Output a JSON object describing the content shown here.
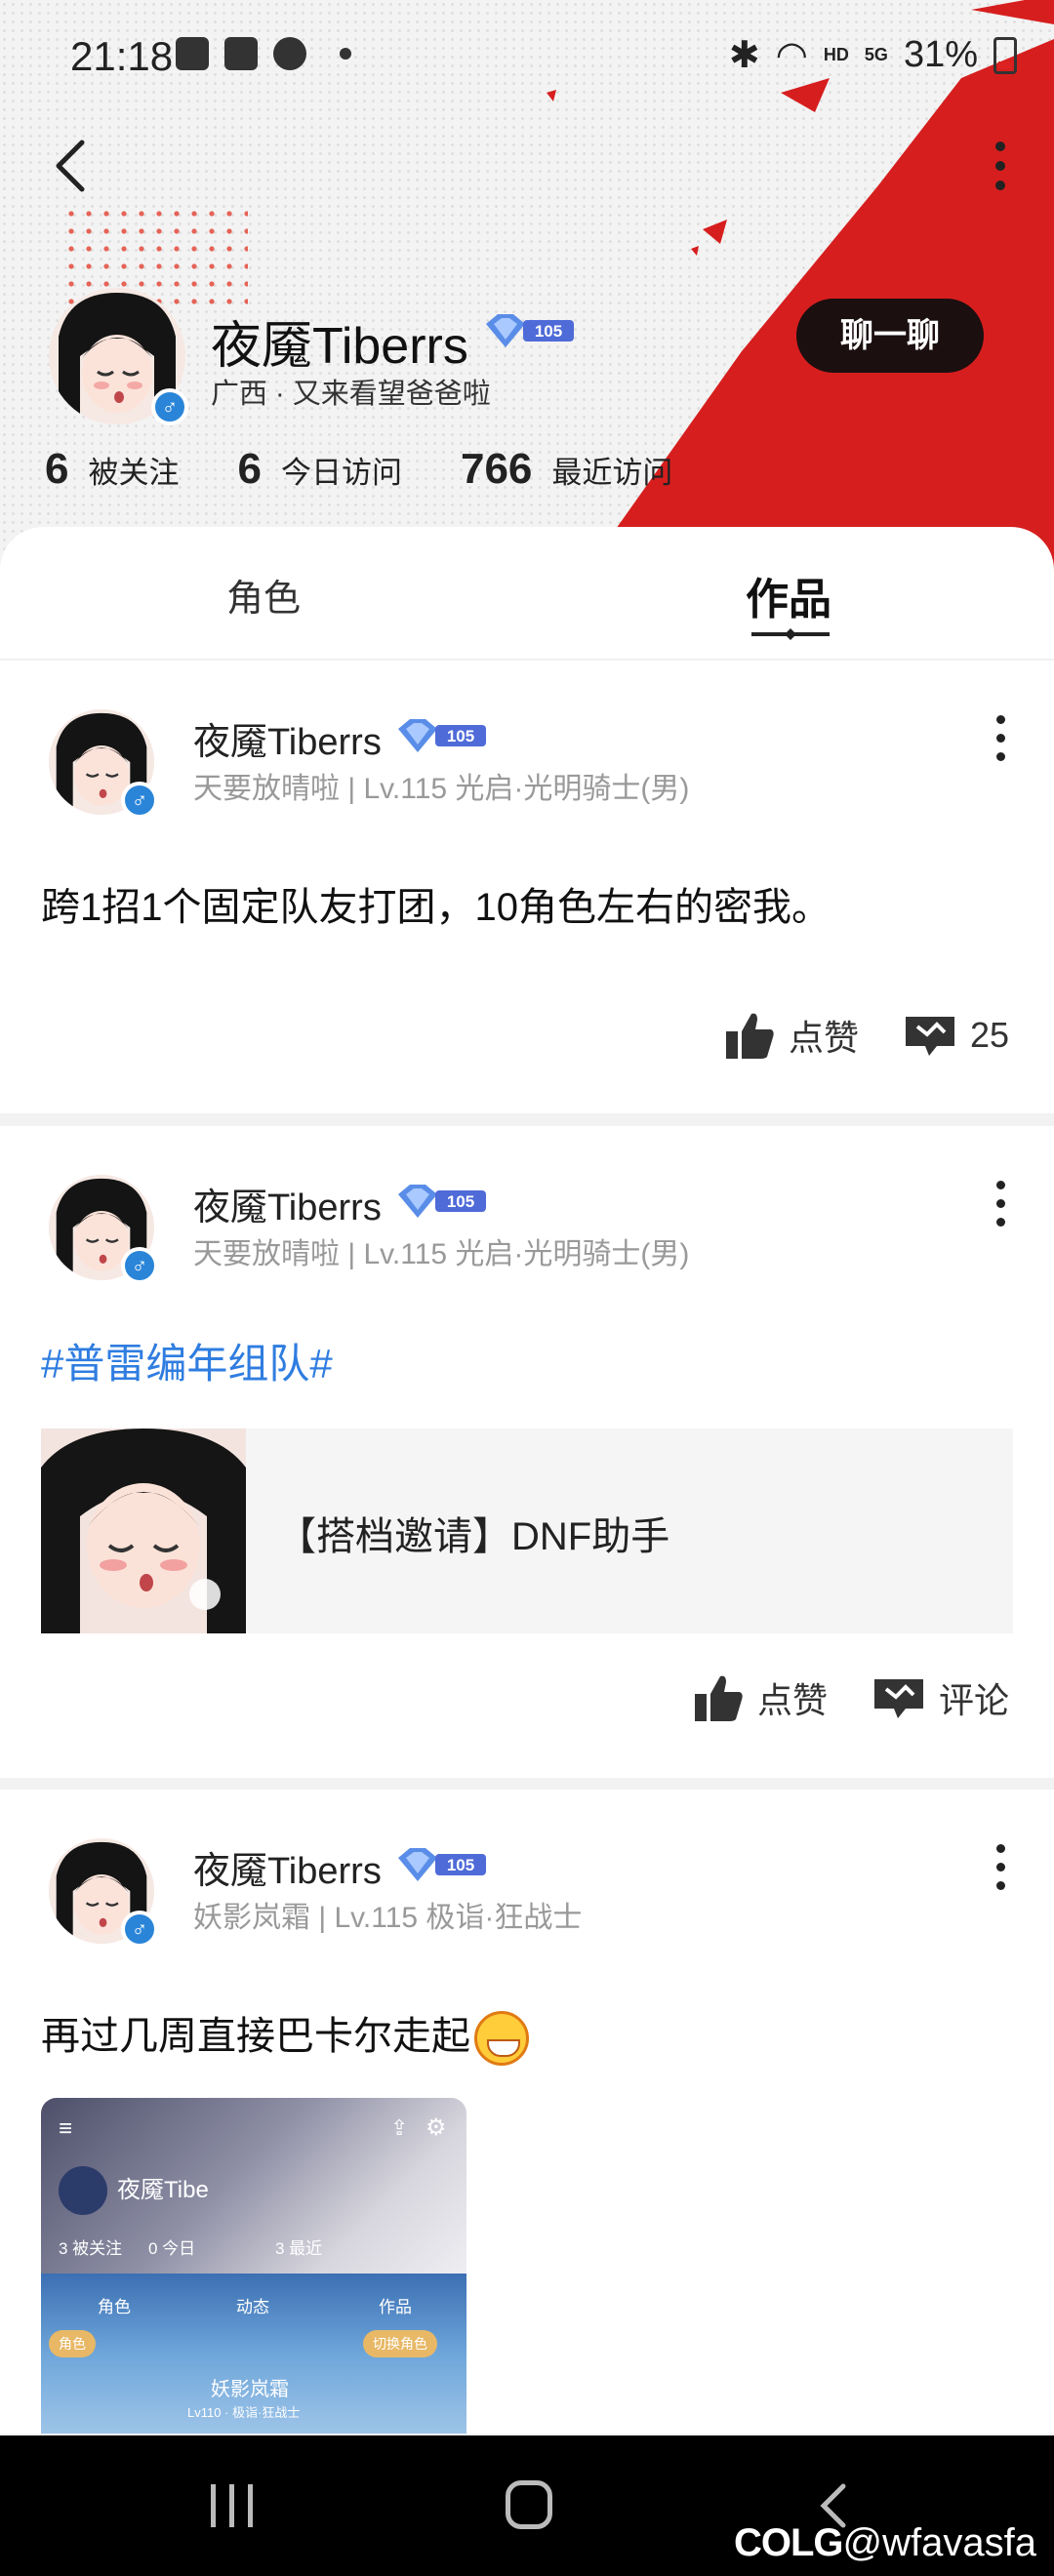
{
  "status_bar": {
    "time": "21:18",
    "network": "HD",
    "signal": "5G",
    "battery": "31%"
  },
  "profile": {
    "name": "夜魇Tiberrs",
    "level": "105",
    "subtitle": "广西 · 又来看望爸爸啦",
    "gender_symbol": "♂",
    "chat_label": "聊一聊",
    "stats": [
      {
        "value": "6",
        "label": "被关注"
      },
      {
        "value": "6",
        "label": "今日访问"
      },
      {
        "value": "766",
        "label": "最近访问"
      }
    ]
  },
  "tabs": [
    {
      "label": "角色"
    },
    {
      "label": "作品",
      "active": true
    }
  ],
  "posts": [
    {
      "author": "夜魇Tiberrs",
      "level": "105",
      "gender_symbol": "♂",
      "meta": "天要放晴啦 | Lv.115 光启·光明骑士(男)",
      "text": "跨1招1个固定队友打团，10角色左右的密我。",
      "like_label": "点赞",
      "comment_count": "25"
    },
    {
      "author": "夜魇Tiberrs",
      "level": "105",
      "gender_symbol": "♂",
      "meta": "天要放晴啦 | Lv.115 光启·光明骑士(男)",
      "hashtag": "#普雷编年组队#",
      "link_title": "【搭档邀请】DNF助手",
      "like_label": "点赞",
      "comment_label": "评论"
    },
    {
      "author": "夜魇Tiberrs",
      "level": "105",
      "gender_symbol": "♂",
      "meta": "妖影岚霜 | Lv.115 极诣·狂战士",
      "text": "再过几周直接巴卡尔走起",
      "emoji": "grinning-face-icon",
      "image": {
        "name": "夜魇Tibe",
        "stats": [
          "3 被关注",
          "0 今日",
          "3 最近"
        ],
        "tabs": [
          "角色",
          "动态",
          "作品"
        ],
        "tag_left": "角色",
        "tag_right": "切换角色",
        "char_name": "妖影岚霜",
        "char_meta": "Lv110 · 极诣·狂战士"
      }
    }
  ],
  "navbar": {
    "watermark_logo": "COLG",
    "watermark_user": "@wfavasfa"
  },
  "colors": {
    "accent_red": "#d71e1e",
    "hashtag_blue": "#2f7de0",
    "gender_blue": "#2a85d8",
    "chat_btn": "#1b0f10"
  }
}
